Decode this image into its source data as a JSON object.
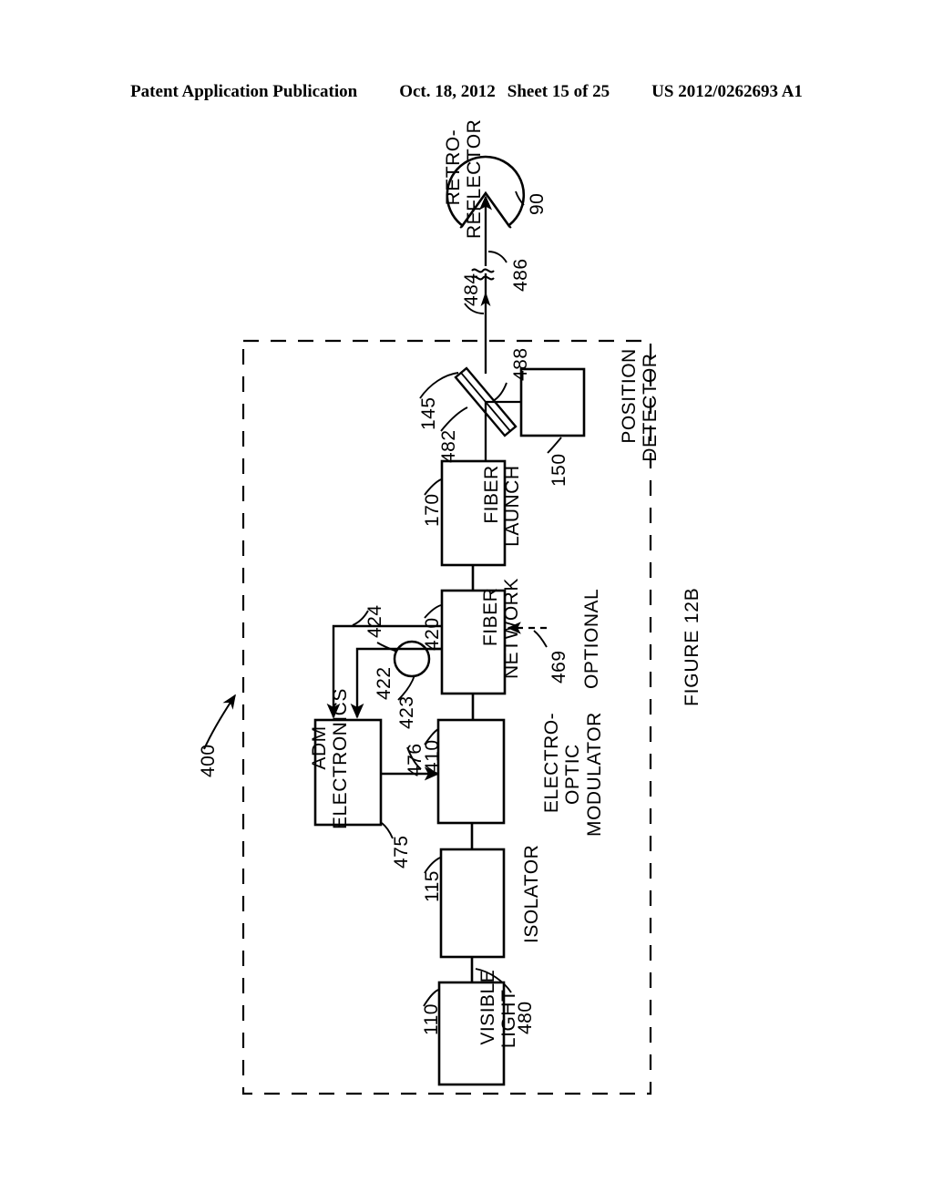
{
  "header": {
    "publication": "Patent Application Publication",
    "date": "Oct. 18, 2012",
    "sheet": "Sheet 15 of 25",
    "patent_number": "US 2012/0262693 A1"
  },
  "figure": {
    "title": "FIGURE 12B",
    "assembly_reference": "400",
    "boundary": "dashed enclosure"
  },
  "blocks": [
    {
      "id": "retro-reflector",
      "label": "RETRO-\nREFLECTOR",
      "ref": "90",
      "shape": "circle-with-v-notch"
    },
    {
      "id": "position-detector",
      "label": "POSITION\nDETECTOR",
      "ref": "150",
      "shape": "rectangle"
    },
    {
      "id": "beam-splitter",
      "label": "",
      "ref": "145",
      "shape": "tilted-parallelogram"
    },
    {
      "id": "fiber-launch",
      "label": "FIBER\nLAUNCH",
      "ref": "170",
      "shape": "rectangle"
    },
    {
      "id": "fiber-network",
      "label": "FIBER\nNETWORK",
      "ref": "420",
      "shape": "rectangle"
    },
    {
      "id": "adm-electronics",
      "label": "ADM\nELECTRONICS",
      "ref": "",
      "shape": "rectangle"
    },
    {
      "id": "electro-optic-modulator",
      "label": "ELECTRO-\nOPTIC\nMODULATOR",
      "ref": "410",
      "shape": "rectangle"
    },
    {
      "id": "isolator",
      "label": "ISOLATOR",
      "ref": "115",
      "shape": "rectangle"
    },
    {
      "id": "visible-light",
      "label": "VISIBLE\nLIGHT",
      "ref": "110",
      "shape": "rectangle"
    },
    {
      "id": "optical-detector",
      "label": "",
      "ref": "423",
      "shape": "circle"
    }
  ],
  "reference_numerals": {
    "retro_reflector": "90",
    "visible_light_source": "110",
    "isolator": "115",
    "beam_splitter": "145",
    "position_detector": "150",
    "fiber_launch": "170",
    "assembly": "400",
    "electro_optic_modulator": "410",
    "fiber_network": "420",
    "signal_422": "422",
    "detector_423": "423",
    "signal_424": "424",
    "optional_input": "469",
    "adm_out_475": "475",
    "adm_out_476": "476",
    "light_path_480": "480",
    "beam_482": "482",
    "beam_484": "484",
    "beam_486": "486",
    "beam_488": "488"
  },
  "annotations": {
    "optional_label": "OPTIONAL",
    "optional_ref": "469"
  }
}
